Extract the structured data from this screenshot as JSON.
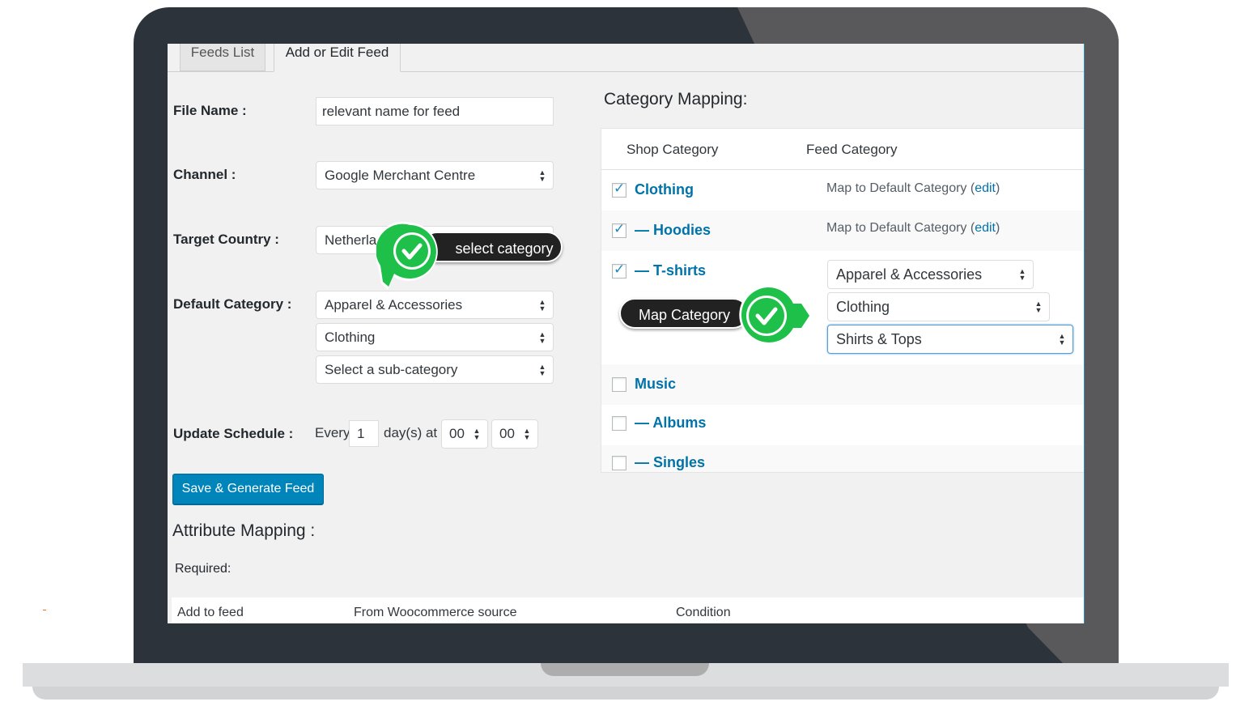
{
  "tabs": [
    {
      "label": "Feeds List",
      "active": false
    },
    {
      "label": "Add or Edit Feed",
      "active": true
    }
  ],
  "form": {
    "file_name": {
      "label": "File Name :",
      "value": "relevant name for feed"
    },
    "channel": {
      "label": "Channel :",
      "value": "Google Merchant Centre"
    },
    "target_country": {
      "label": "Target Country :",
      "value": "Netherlan"
    },
    "default_category": {
      "label": "Default Category :",
      "level1": "Apparel & Accessories",
      "level2": "Clothing",
      "level3": "Select a sub-category"
    },
    "update_schedule": {
      "label": "Update Schedule :",
      "every": "Every",
      "days_value": "1",
      "days_suffix": "day(s) at",
      "hour": "00",
      "minute": "00"
    },
    "save_button": "Save & Generate Feed"
  },
  "attribute_mapping": {
    "title": "Attribute Mapping :",
    "required_label": "Required:",
    "columns": [
      "Add to feed",
      "From Woocommerce source",
      "Condition"
    ]
  },
  "category_mapping": {
    "title": "Category Mapping:",
    "columns": [
      "Shop Category",
      "Feed Category"
    ],
    "rows": [
      {
        "name": "Clothing",
        "checked": true,
        "mapping": "Map to Default Category (",
        "edit": "edit",
        "close": ")"
      },
      {
        "name": "— Hoodies",
        "checked": true,
        "mapping": "Map to Default Category (",
        "edit": "edit",
        "close": ")"
      },
      {
        "name": "— T-shirts",
        "checked": true,
        "selects": [
          "Apparel & Accessories",
          "Clothing",
          "Shirts & Tops"
        ]
      },
      {
        "name": "Music",
        "checked": false
      },
      {
        "name": "— Albums",
        "checked": false
      },
      {
        "name": "— Singles",
        "checked": false
      }
    ]
  },
  "callouts": {
    "select_category": "select category",
    "map_category": "Map Category"
  },
  "icons": {
    "checkmark": "✓",
    "select_arrows": "▲▼"
  },
  "colors": {
    "accent_blue": "#0085ba",
    "link_blue": "#0073aa",
    "badge_green": "#1ec04a",
    "pill_dark": "#222222"
  }
}
